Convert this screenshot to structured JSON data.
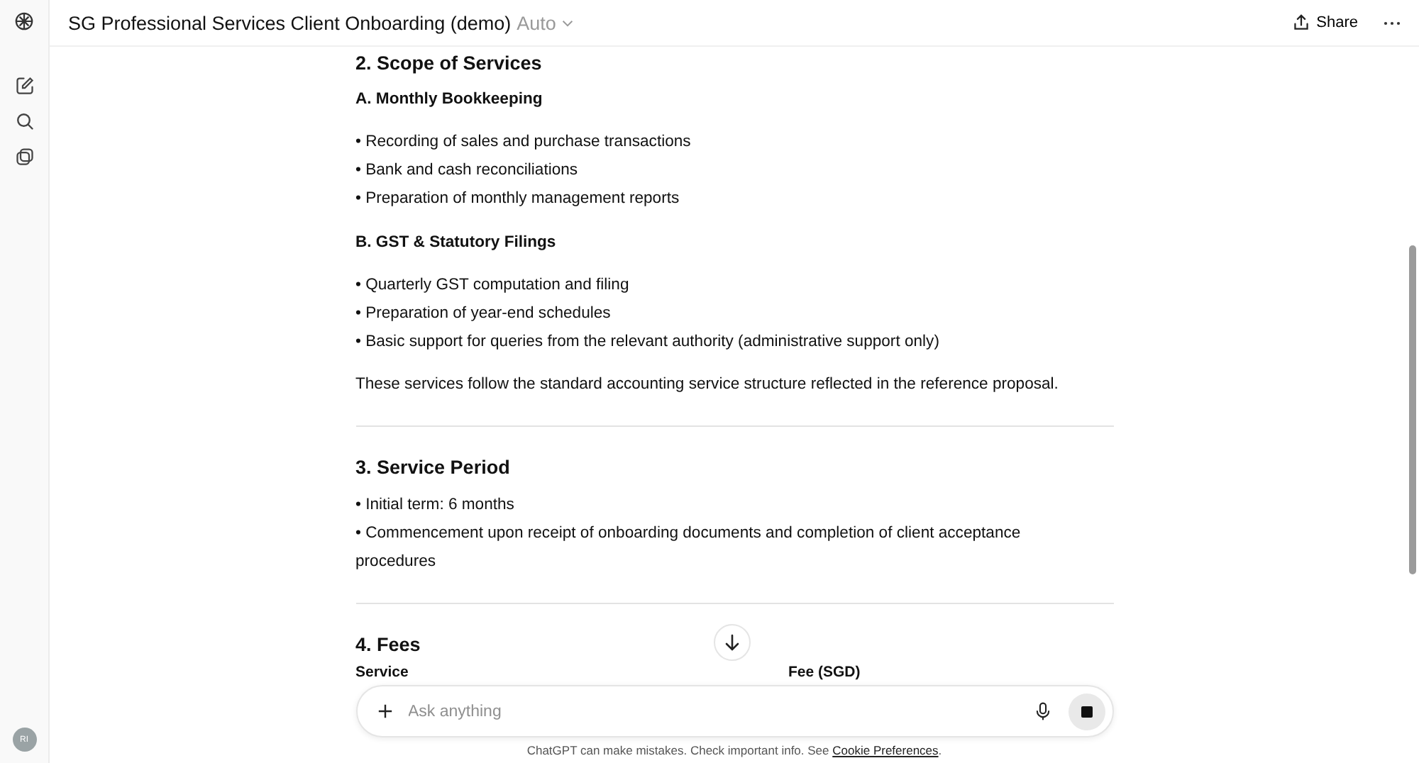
{
  "header": {
    "title": "SG Professional Services Client Onboarding (demo)",
    "model": "Auto",
    "share": "Share"
  },
  "user": {
    "initials": "RI"
  },
  "blocks": [
    {
      "kind": "heading",
      "text": "2. Scope of Services"
    },
    {
      "kind": "subheading",
      "text": "A. Monthly Bookkeeping"
    },
    {
      "kind": "bullet",
      "text": "• Recording of sales and purchase transactions"
    },
    {
      "kind": "bullet",
      "text": "• Bank and cash reconciliations"
    },
    {
      "kind": "bullet",
      "text": "• Preparation of monthly management reports"
    },
    {
      "kind": "subheading",
      "text": "B. GST & Statutory Filings"
    },
    {
      "kind": "bullet",
      "text": "• Quarterly GST computation and filing"
    },
    {
      "kind": "bullet",
      "text": "• Preparation of year-end schedules"
    },
    {
      "kind": "bullet",
      "text": "• Basic support for queries from the relevant authority (administrative support only)"
    },
    {
      "kind": "paragraph",
      "text": "These services follow the standard accounting service structure reflected in the reference proposal."
    },
    {
      "kind": "divider"
    },
    {
      "kind": "heading",
      "text": "3. Service Period"
    },
    {
      "kind": "bullet",
      "text": "• Initial term: 6 months"
    },
    {
      "kind": "bullet",
      "text": "• Commencement upon receipt of onboarding documents and completion of client acceptance procedures"
    },
    {
      "kind": "divider"
    },
    {
      "kind": "heading",
      "text": "4. Fees"
    },
    {
      "kind": "table_head",
      "columns": [
        "Service",
        "Fee (SGD)"
      ]
    }
  ],
  "composer": {
    "placeholder": "Ask anything"
  },
  "footer": {
    "text": "ChatGPT can make mistakes. Check important info. See ",
    "link": "Cookie Preferences",
    "end": "."
  }
}
